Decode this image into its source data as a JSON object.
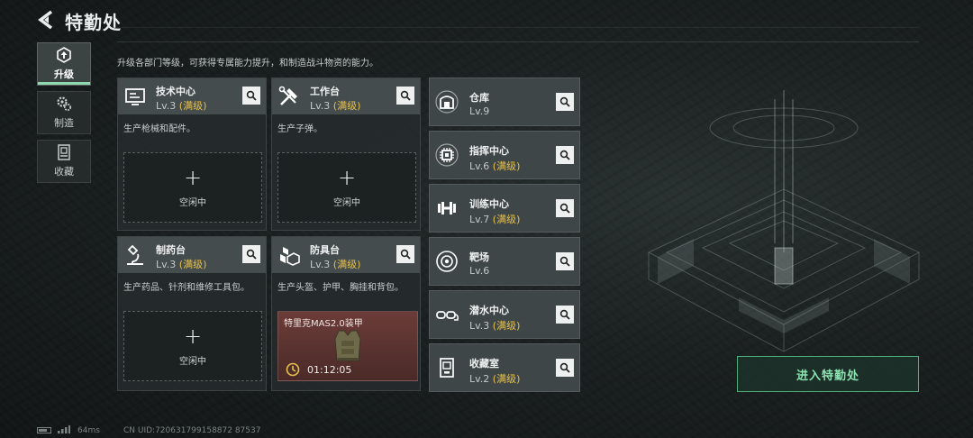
{
  "header": {
    "title": "特勤处"
  },
  "nav": [
    {
      "label": "升级",
      "active": true
    },
    {
      "label": "制造",
      "active": false
    },
    {
      "label": "收藏",
      "active": false
    }
  ],
  "description": "升级各部门等级，可获得专属能力提升，和制造战斗物资的能力。",
  "departments": [
    {
      "name": "技术中心",
      "level": "Lv.3",
      "max": "(满级)",
      "text": "生产枪械和配件。",
      "slot": {
        "plus": "+",
        "status": "空闲中"
      }
    },
    {
      "name": "工作台",
      "level": "Lv.3",
      "max": "(满级)",
      "text": "生产子弹。",
      "slot": {
        "plus": "+",
        "status": "空闲中"
      }
    },
    {
      "name": "制药台",
      "level": "Lv.3",
      "max": "(满级)",
      "text": "生产药品、针剂和维修工具包。",
      "slot": {
        "plus": "+",
        "status": "空闲中"
      }
    },
    {
      "name": "防具台",
      "level": "Lv.3",
      "max": "(满级)",
      "text": "生产头盔、护甲、胸挂和背包。",
      "crafting": {
        "item": "特里克MAS2.0装甲",
        "timer": "01:12:05"
      }
    }
  ],
  "facilities": [
    {
      "name": "仓库",
      "level": "Lv.9",
      "max": "",
      "icon": "warehouse-icon"
    },
    {
      "name": "指挥中心",
      "level": "Lv.6",
      "max": "(满级)",
      "icon": "chip-icon"
    },
    {
      "name": "训练中心",
      "level": "Lv.7",
      "max": "(满级)",
      "icon": "dumbbell-icon"
    },
    {
      "name": "靶场",
      "level": "Lv.6",
      "max": "",
      "icon": "target-icon"
    },
    {
      "name": "潜水中心",
      "level": "Lv.3",
      "max": "(满级)",
      "icon": "diving-mask-icon"
    },
    {
      "name": "收藏室",
      "level": "Lv.2",
      "max": "(满级)",
      "icon": "display-case-icon"
    }
  ],
  "enter_button": "进入特勤处",
  "footer": {
    "ping": "64ms",
    "uid": "CN UID:720631799158872 87537"
  },
  "colors": {
    "accent": "#8fd8b0",
    "max_level": "#e7c14c",
    "enter_border": "#4fae7c"
  }
}
